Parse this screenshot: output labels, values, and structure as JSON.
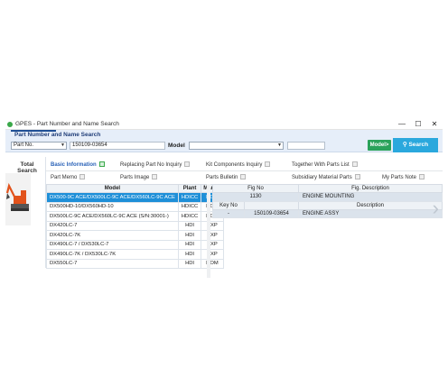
{
  "window": {
    "title": "GPES - Part Number and Name Search",
    "controls": [
      "—",
      "☐",
      "✕"
    ]
  },
  "header": {
    "title": "Part Number and Name Search"
  },
  "search": {
    "type_value": "Part No.",
    "part_value": "150109-03654",
    "model_label": "Model",
    "model_btn": "Model>",
    "search_btn": "Search"
  },
  "left": {
    "total_label": "Total Search"
  },
  "tabs": {
    "basic_info": "Basic Information",
    "replacing": "Replacing Part No Inquiry",
    "kit": "Kit Components Inquiry",
    "together": "Together With Parts List",
    "part_memo": "Part Memo",
    "parts_image": "Parts Image",
    "parts_bulletin": "Parts Bulletin",
    "subsidiary": "Subsidiary Material Parts",
    "my_parts_note": "My Parts Note"
  },
  "models_table": {
    "headers": [
      "Model",
      "Plant",
      "Market"
    ],
    "rows": [
      [
        "DX500-9C ACE/DX500LC-9C ACE/DX560LC-9C ACE",
        "HDICC",
        "DOM"
      ],
      [
        "DX500HD-10/DX560HD-10",
        "HDICC",
        "DOM"
      ],
      [
        "DX500LC-9C ACE/DX560LC-9C ACE (S/N:30001-)",
        "HDICC",
        "DOM"
      ],
      [
        "DX420LC-7",
        "HDI",
        "EXP"
      ],
      [
        "DX420LC-7K",
        "HDI",
        "EXP"
      ],
      [
        "DX490LC-7 / DX530LC-7",
        "HDI",
        "EXP"
      ],
      [
        "DX490LC-7K / DX530LC-7K",
        "HDI",
        "EXP"
      ],
      [
        "DX550LC-7",
        "HDI",
        "DOM"
      ]
    ]
  },
  "fig_table": {
    "headers": [
      "Fig No",
      "Fig. Description"
    ],
    "row": [
      "1130",
      "ENGINE MOUNTING"
    ],
    "sub_headers": [
      "Key No",
      "",
      "Description"
    ],
    "sub_row": [
      "-",
      "150109-03654",
      "ENGINE ASSY"
    ]
  },
  "colors": {
    "accent": "#2aa8dd",
    "selected": "#1e8fd8",
    "model_btn": "#2aa25a"
  }
}
